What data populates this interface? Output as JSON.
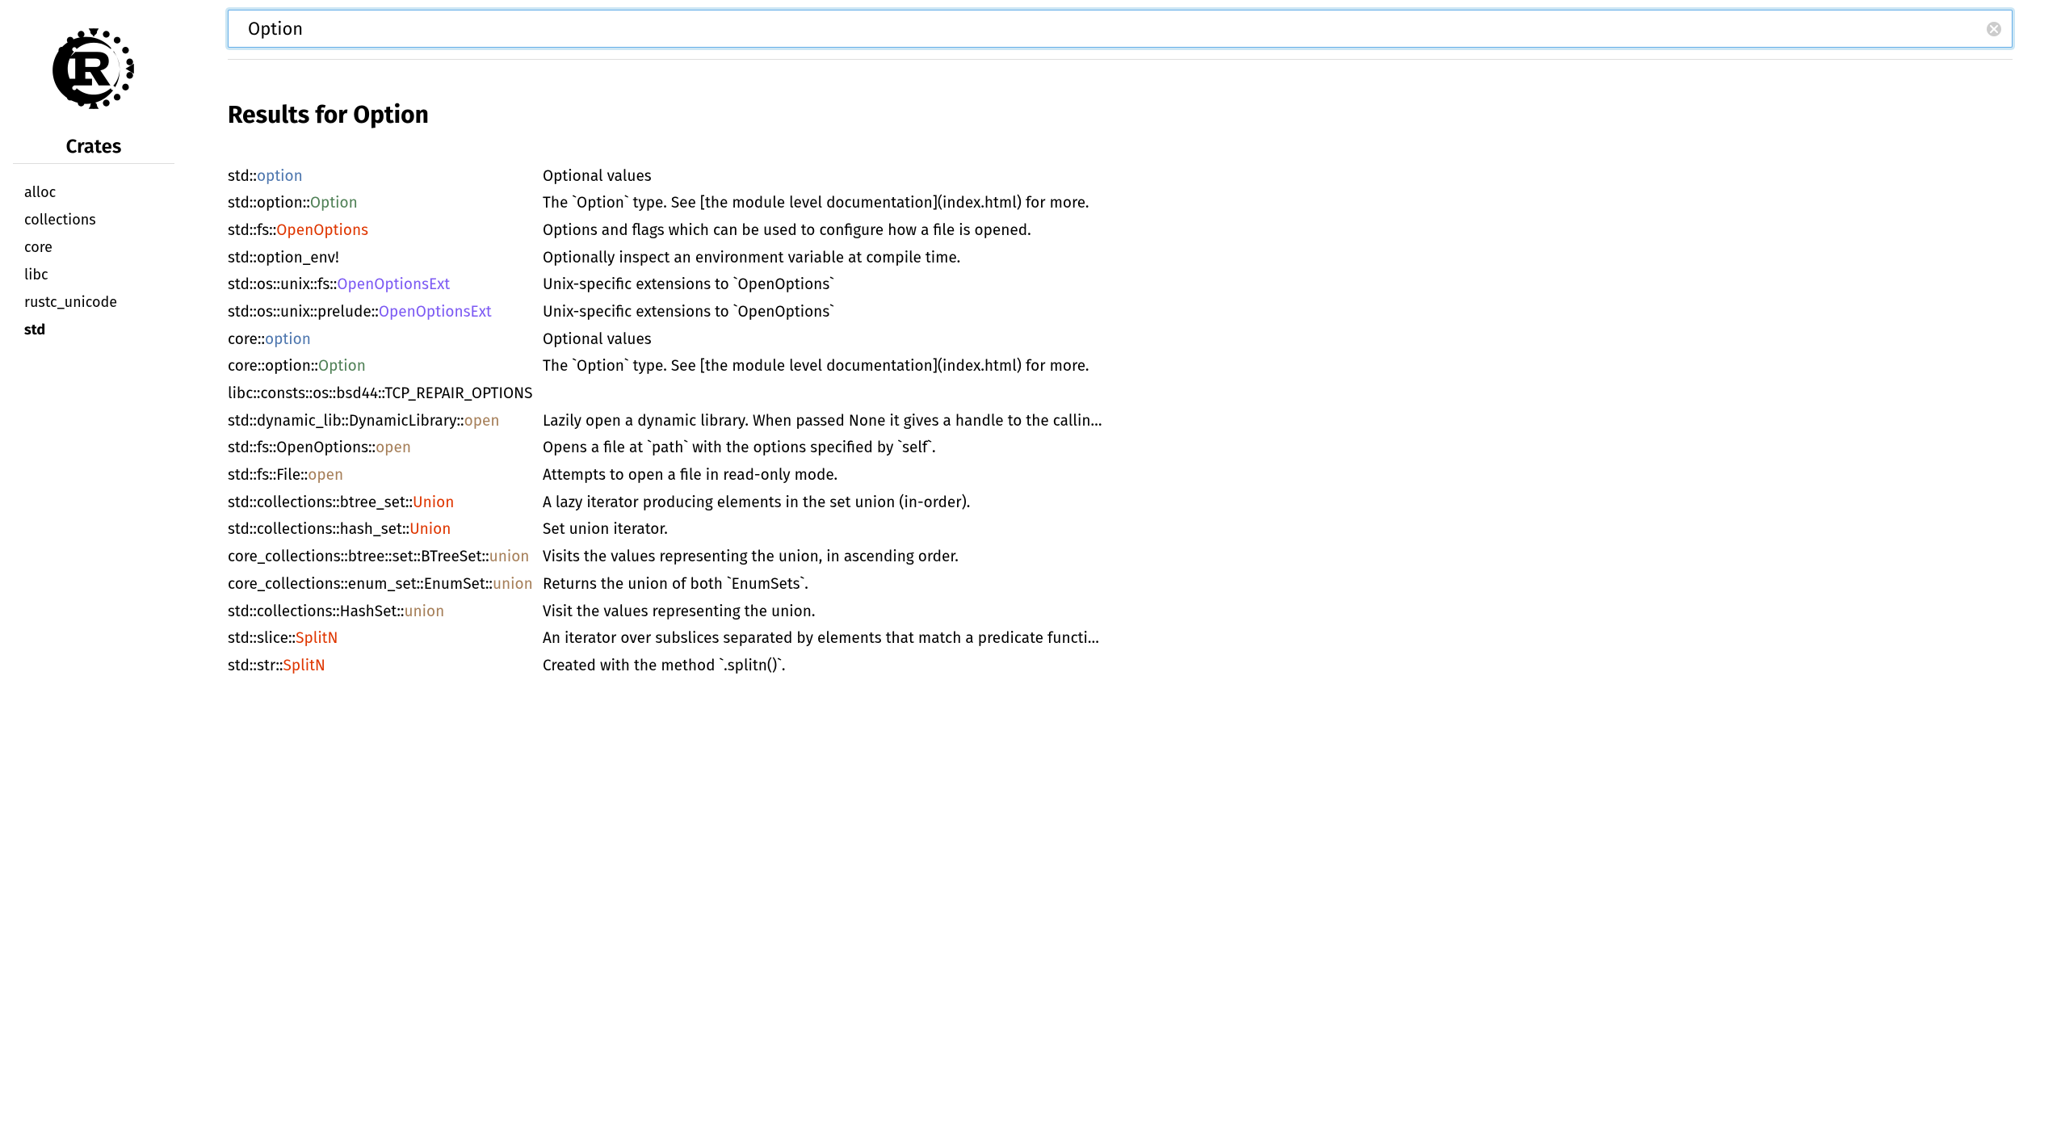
{
  "sidebar": {
    "heading": "Crates",
    "crates": [
      {
        "name": "alloc",
        "current": false
      },
      {
        "name": "collections",
        "current": false
      },
      {
        "name": "core",
        "current": false
      },
      {
        "name": "libc",
        "current": false
      },
      {
        "name": "rustc_unicode",
        "current": false
      },
      {
        "name": "std",
        "current": true
      }
    ]
  },
  "search": {
    "value": "Option"
  },
  "results_heading": "Results for Option",
  "results": [
    {
      "path_prefix": "std::",
      "item": "option",
      "item_class": "c-module",
      "desc": "Optional values"
    },
    {
      "path_prefix": "std::option::",
      "item": "Option",
      "item_class": "c-enum",
      "desc": "The `Option` type. See [the module level documentation](index.html) for more."
    },
    {
      "path_prefix": "std::fs::",
      "item": "OpenOptions",
      "item_class": "c-struct",
      "desc": "Options and flags which can be used to configure how a file is opened."
    },
    {
      "path_prefix": "std::",
      "item": "option_env!",
      "item_class": "",
      "desc": "Optionally inspect an environment variable at compile time."
    },
    {
      "path_prefix": "std::os::unix::fs::",
      "item": "OpenOptionsExt",
      "item_class": "c-trait",
      "desc": "Unix-specific extensions to `OpenOptions`"
    },
    {
      "path_prefix": "std::os::unix::prelude::",
      "item": "OpenOptionsExt",
      "item_class": "c-trait",
      "desc": "Unix-specific extensions to `OpenOptions`"
    },
    {
      "path_prefix": "core::",
      "item": "option",
      "item_class": "c-module",
      "desc": "Optional values"
    },
    {
      "path_prefix": "core::option::",
      "item": "Option",
      "item_class": "c-enum",
      "desc": "The `Option` type. See [the module level documentation](index.html) for more."
    },
    {
      "path_prefix": "libc::consts::os::bsd44::",
      "item": "TCP_REPAIR_OPTIONS",
      "item_class": "",
      "desc": ""
    },
    {
      "path_prefix": "std::dynamic_lib::DynamicLibrary::",
      "item": "open",
      "item_class": "c-method",
      "desc": "Lazily open a dynamic library. When passed None it gives a handle to the callin…"
    },
    {
      "path_prefix": "std::fs::OpenOptions::",
      "item": "open",
      "item_class": "c-method",
      "desc": "Opens a file at `path` with the options specified by `self`."
    },
    {
      "path_prefix": "std::fs::File::",
      "item": "open",
      "item_class": "c-method",
      "desc": "Attempts to open a file in read-only mode."
    },
    {
      "path_prefix": "std::collections::btree_set::",
      "item": "Union",
      "item_class": "c-struct",
      "desc": "A lazy iterator producing elements in the set union (in-order)."
    },
    {
      "path_prefix": "std::collections::hash_set::",
      "item": "Union",
      "item_class": "c-struct",
      "desc": "Set union iterator."
    },
    {
      "path_prefix": "core_collections::btree::set::BTreeSet::",
      "item": "union",
      "item_class": "c-method",
      "desc": "Visits the values representing the union, in ascending order."
    },
    {
      "path_prefix": "core_collections::enum_set::EnumSet::",
      "item": "union",
      "item_class": "c-method",
      "desc": "Returns the union of both `EnumSets`."
    },
    {
      "path_prefix": "std::collections::HashSet::",
      "item": "union",
      "item_class": "c-method",
      "desc": "Visit the values representing the union."
    },
    {
      "path_prefix": "std::slice::",
      "item": "SplitN",
      "item_class": "c-struct",
      "desc": "An iterator over subslices separated by elements that match a predicate functi…"
    },
    {
      "path_prefix": "std::str::",
      "item": "SplitN",
      "item_class": "c-struct",
      "desc": "Created with the method `.splitn()`."
    }
  ]
}
